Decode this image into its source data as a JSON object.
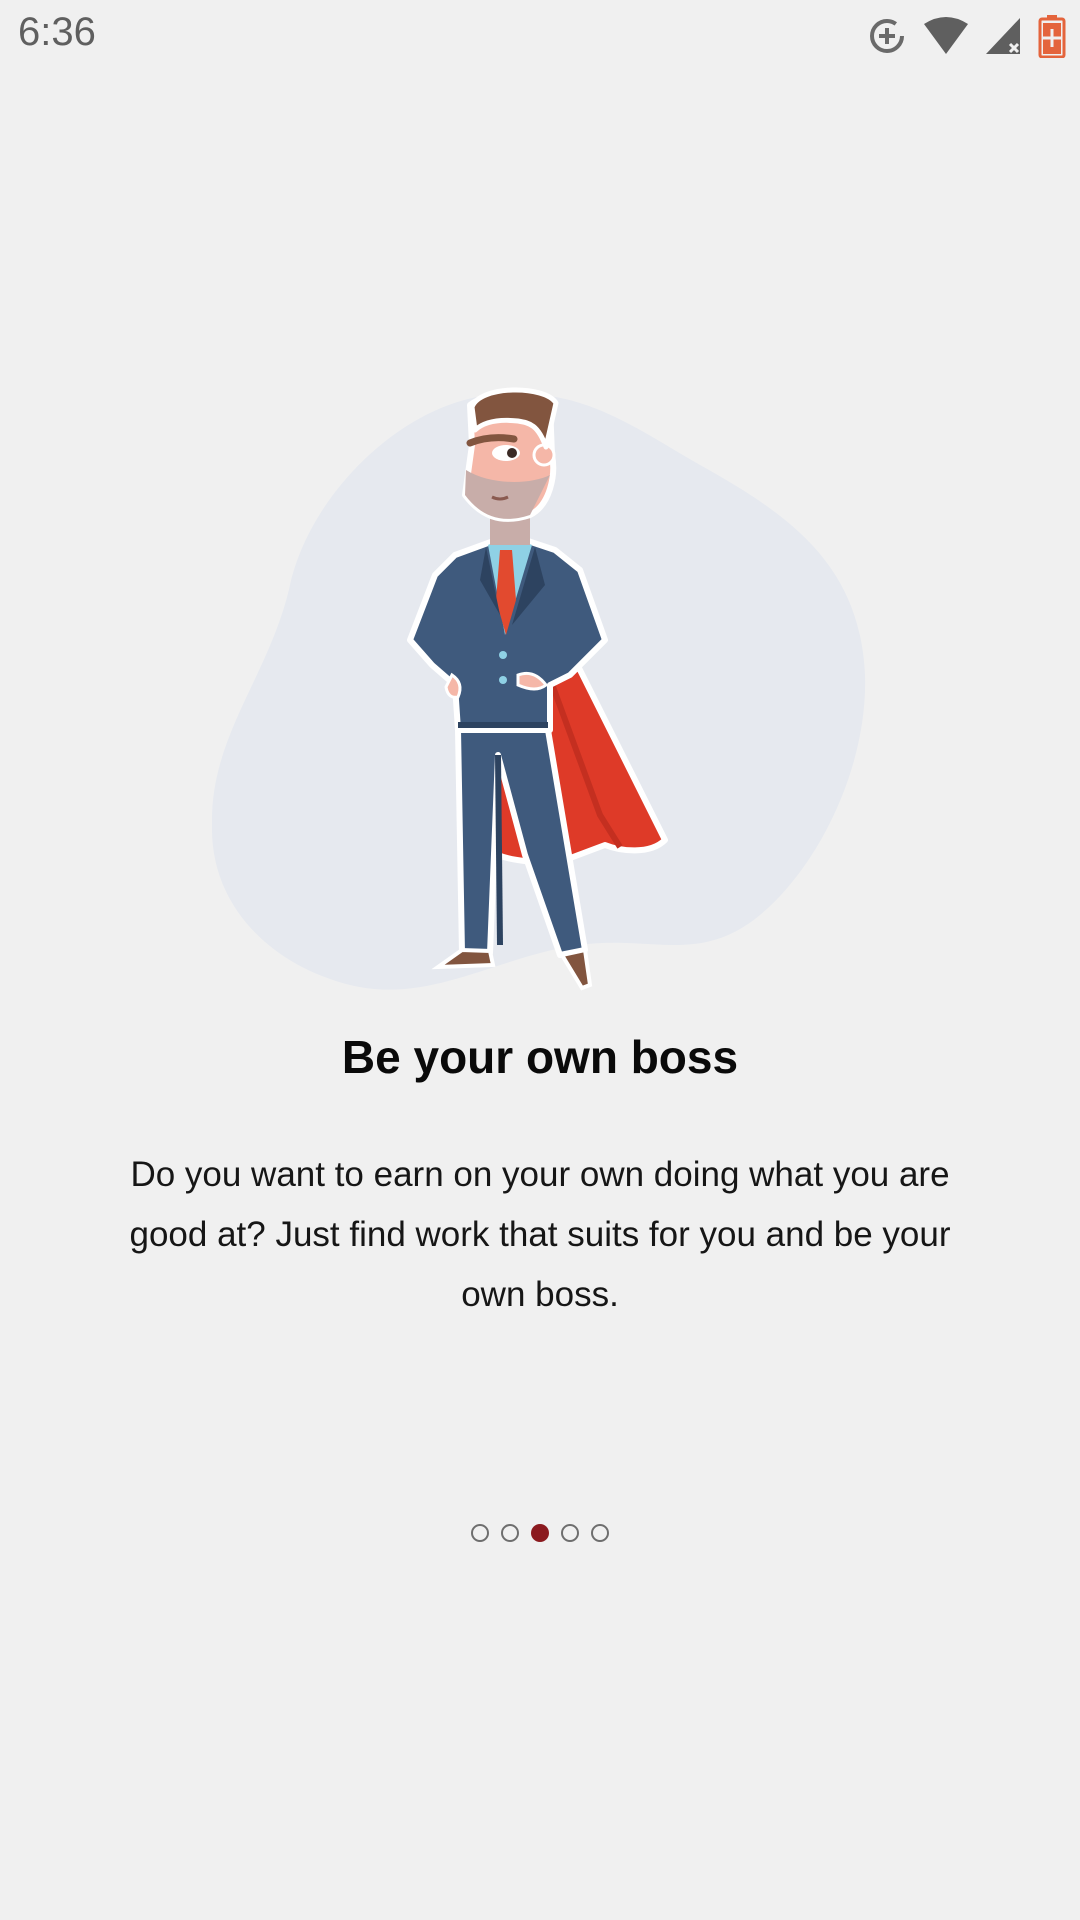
{
  "status_bar": {
    "time": "6:36",
    "icons": [
      "sync-icon",
      "wifi-icon",
      "cell-signal-icon",
      "battery-charging-icon"
    ],
    "battery_color": "#e4643c"
  },
  "onboarding": {
    "illustration": "superhero-businessman-illustration",
    "title": "Be your own boss",
    "body": "Do you want to earn on your own doing what you are good at? Just find work that suits for you and be your own boss."
  },
  "pager": {
    "total": 5,
    "current_index": 2,
    "active_color": "#8b1a1f"
  }
}
